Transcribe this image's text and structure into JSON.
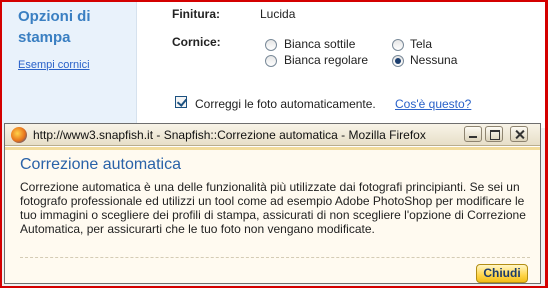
{
  "left_panel": {
    "title": "Opzioni di stampa",
    "examples_link": "Esempi cornici"
  },
  "options": {
    "finish_label": "Finitura:",
    "finish_value": "Lucida",
    "frame_label": "Cornice:",
    "frame_choices": [
      {
        "label": "Bianca sottile",
        "selected": false
      },
      {
        "label": "Tela",
        "selected": false
      },
      {
        "label": "Bianca regolare",
        "selected": false
      },
      {
        "label": "Nessuna",
        "selected": true
      }
    ],
    "autocorrect_checkbox_label": "Correggi le foto automaticamente.",
    "autocorrect_checked": true,
    "whats_this_link": "Cos'è questo?"
  },
  "popup": {
    "window_title": "http://www3.snapfish.it - Snapfish::Correzione automatica - Mozilla Firefox",
    "heading": "Correzione automatica",
    "body_text": "Correzione automatica è una delle funzionalità più utilizzate dai fotografi principianti. Se sei un fotografo professionale ed utilizzi un tool come ad esempio Adobe PhotoShop per modificare le tuo immagini o scegliere dei profili di stampa, assicurati di non scegliere l'opzione di Correzione Automatica, per assicurarti che le tuo foto non vengano modificate.",
    "close_button": "Chiudi"
  },
  "colors": {
    "frame_red": "#d40000",
    "heading_blue": "#2a62a8",
    "link_blue": "#2a62c9",
    "button_yellow": "#ffd54a"
  }
}
